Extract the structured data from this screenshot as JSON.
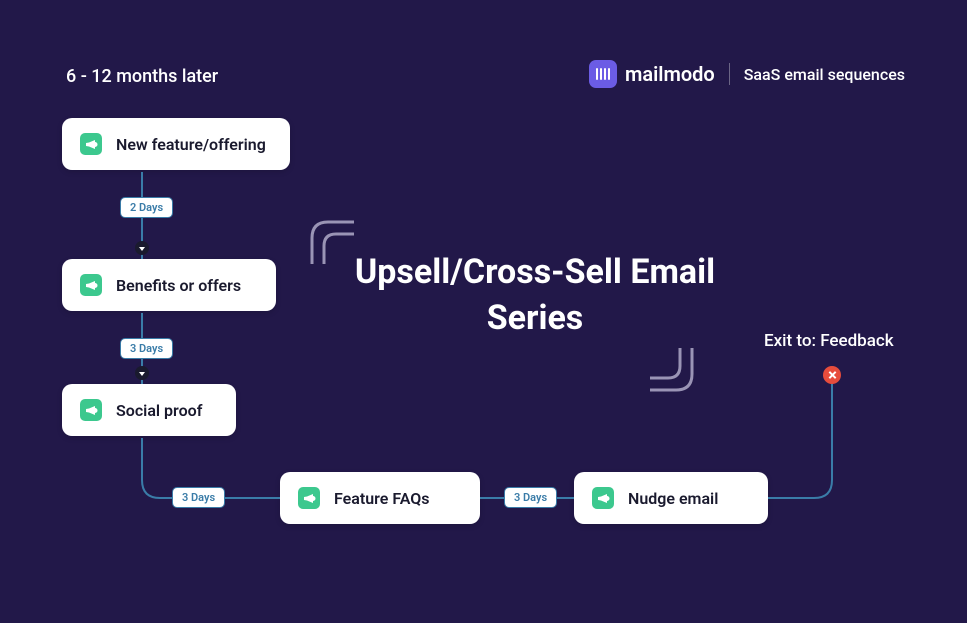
{
  "header_label": "6 - 12 months later",
  "brand": {
    "name": "mailmodo",
    "tagline": "SaaS email sequences"
  },
  "title": "Upsell/Cross-Sell Email Series",
  "exit_label": "Exit to: Feedback",
  "nodes": [
    {
      "label": "New feature/offering"
    },
    {
      "label": "Benefits or offers"
    },
    {
      "label": "Social proof"
    },
    {
      "label": "Feature FAQs"
    },
    {
      "label": "Nudge email"
    }
  ],
  "delays": [
    {
      "label": "2 Days"
    },
    {
      "label": "3 Days"
    },
    {
      "label": "3 Days"
    },
    {
      "label": "3 Days"
    }
  ]
}
